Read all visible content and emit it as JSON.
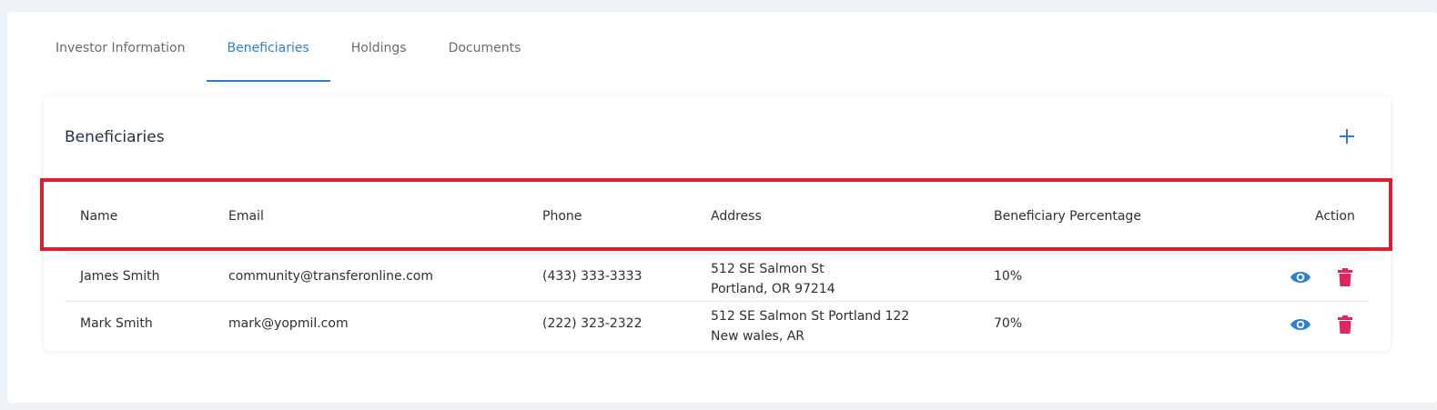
{
  "tabs": [
    {
      "label": "Investor Information"
    },
    {
      "label": "Beneficiaries",
      "active": true
    },
    {
      "label": "Holdings"
    },
    {
      "label": "Documents"
    }
  ],
  "card": {
    "title": "Beneficiaries",
    "add_icon": "plus-icon"
  },
  "table": {
    "headers": {
      "name": "Name",
      "email": "Email",
      "phone": "Phone",
      "address": "Address",
      "percentage": "Beneficiary Percentage",
      "action": "Action"
    },
    "rows": [
      {
        "name": "James Smith",
        "email": "community@transferonline.com",
        "phone": "(433) 333-3333",
        "address_line1": "512 SE Salmon St",
        "address_line2": "Portland, OR 97214",
        "percentage": "10%"
      },
      {
        "name": "Mark Smith",
        "email": "mark@yopmil.com",
        "phone": "(222) 323-2322",
        "address_line1": "512 SE Salmon St Portland 122",
        "address_line2": "New wales, AR",
        "percentage": "70%"
      }
    ]
  },
  "colors": {
    "accent": "#2f7fd1",
    "delete": "#e0245e",
    "highlight": "#d9202e"
  }
}
